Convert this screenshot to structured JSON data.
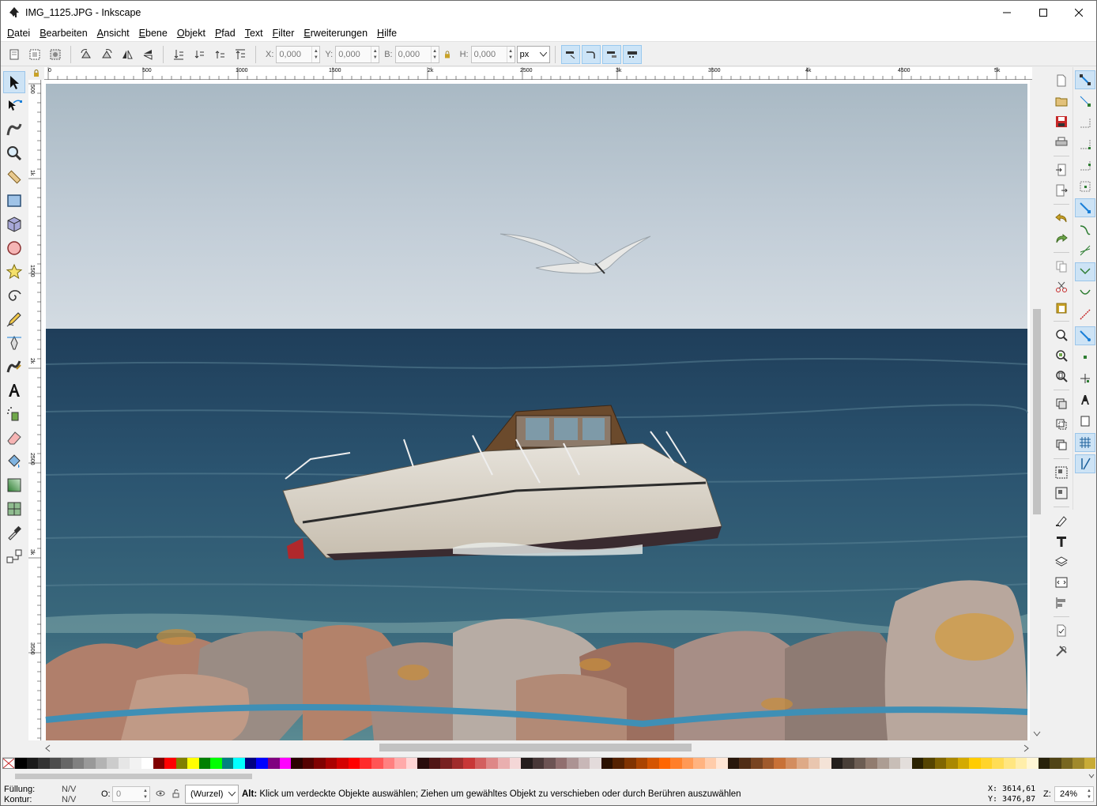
{
  "window": {
    "title": "IMG_1125.JPG - Inkscape"
  },
  "menu": [
    "Datei",
    "Bearbeiten",
    "Ansicht",
    "Ebene",
    "Objekt",
    "Pfad",
    "Text",
    "Filter",
    "Erweiterungen",
    "Hilfe"
  ],
  "toolbar": {
    "x_label": "X:",
    "x_value": "0,000",
    "y_label": "Y:",
    "y_value": "0,000",
    "w_label": "B:",
    "w_value": "0,000",
    "h_label": "H:",
    "h_value": "0,000",
    "unit": "px"
  },
  "tools": [
    "select-tool",
    "node-tool",
    "tweak-tool",
    "zoom-tool",
    "measure-tool",
    "rectangle-tool",
    "3dbox-tool",
    "ellipse-tool",
    "star-tool",
    "spiral-tool",
    "pencil-tool",
    "pen-tool",
    "calligraphy-tool",
    "text-tool",
    "spray-tool",
    "eraser-tool",
    "paint-bucket-tool",
    "gradient-tool",
    "mesh-tool",
    "dropper-tool",
    "connector-tool"
  ],
  "ruler": {
    "top_labels": [
      "0",
      "500",
      "1000",
      "1500",
      "2k",
      "2500",
      "3k",
      "3500",
      "4k",
      "4500",
      "5k"
    ],
    "left_labels": [
      "500",
      "1k",
      "1500",
      "2k",
      "2500",
      "3k",
      "3500"
    ]
  },
  "status": {
    "fill_label": "Füllung:",
    "fill_value": "N/V",
    "stroke_label": "Kontur:",
    "stroke_value": "N/V",
    "opacity_label": "O:",
    "opacity_value": "0",
    "layer": "(Wurzel)",
    "message_key": "Alt:",
    "message": " Klick um verdeckte Objekte auswählen; Ziehen um gewähltes Objekt zu verschieben oder durch Berühren auszuwählen",
    "x_coord": "X: 3614,61",
    "y_coord": "Y: 3476,87",
    "zoom_label": "Z:",
    "zoom_value": "24%"
  },
  "palette_colors": [
    "#000000",
    "#1a1a1a",
    "#333333",
    "#4d4d4d",
    "#666666",
    "#808080",
    "#999999",
    "#b3b3b3",
    "#cccccc",
    "#e6e6e6",
    "#f2f2f2",
    "#ffffff",
    "#800000",
    "#ff0000",
    "#808000",
    "#ffff00",
    "#008000",
    "#00ff00",
    "#008080",
    "#00ffff",
    "#000080",
    "#0000ff",
    "#800080",
    "#ff00ff",
    "#2b0000",
    "#550000",
    "#800000",
    "#aa0000",
    "#d40000",
    "#ff0000",
    "#ff2a2a",
    "#ff5555",
    "#ff8080",
    "#ffaaaa",
    "#ffd5d5",
    "#280b0b",
    "#501616",
    "#782121",
    "#a02c2c",
    "#c83737",
    "#d35f5f",
    "#de8787",
    "#e9afaf",
    "#f4d7d7",
    "#241c1c",
    "#483737",
    "#6c5353",
    "#916f6f",
    "#ac9393",
    "#c8b7b7",
    "#e3dbdb",
    "#2b1100",
    "#552200",
    "#803300",
    "#aa4400",
    "#d45500",
    "#ff6600",
    "#ff7f2a",
    "#ff9955",
    "#ffb380",
    "#ffccaa",
    "#ffe6d5",
    "#28170b",
    "#502d16",
    "#784421",
    "#a05a2c",
    "#c87137",
    "#d38d5f",
    "#deaa87",
    "#e9c6af",
    "#f4e3d7",
    "#241f1c",
    "#483e37",
    "#6c5d53",
    "#917c6f",
    "#ac9d93",
    "#c8beb7",
    "#e3dedb",
    "#2b2200",
    "#554400",
    "#806600",
    "#aa8800",
    "#d4aa00",
    "#ffcc00",
    "#ffd42a",
    "#ffdd55",
    "#ffe680",
    "#ffeeaa",
    "#fff6d5",
    "#28220b",
    "#504416",
    "#786721",
    "#a0892c",
    "#c8ab37"
  ]
}
